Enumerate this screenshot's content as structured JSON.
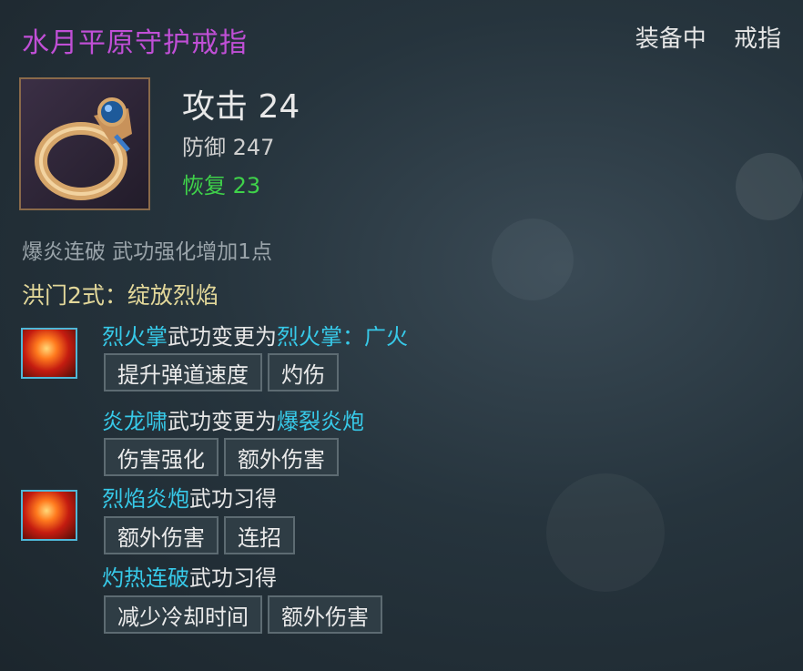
{
  "item": {
    "name": "水月平原守护戒指",
    "status": "装备中",
    "slot": "戒指",
    "attack": "攻击 24",
    "defense": "防御 247",
    "recovery": "恢复 23",
    "passive": "爆炎连破 武功强化增加1点",
    "set_name": "洪门2式：绽放烈焰",
    "icon": "ring-icon"
  },
  "skills": [
    {
      "icon": "fire-palm-skill-icon",
      "name": "烈火掌",
      "text": "武功变更为",
      "target": "烈火掌：广火",
      "tags": [
        "提升弹道速度",
        "灼伤"
      ]
    },
    {
      "name": "炎龙啸",
      "text": "武功变更为",
      "target": "爆裂炎炮",
      "tags": [
        "伤害强化",
        "额外伤害"
      ]
    },
    {
      "icon": "flame-cannon-skill-icon",
      "name": "烈焰炎炮",
      "text": "武功习得",
      "target": "",
      "tags": [
        "额外伤害",
        "连招"
      ]
    },
    {
      "name": "灼热连破",
      "text": "武功习得",
      "target": "",
      "tags": [
        "减少冷却时间",
        "额外伤害"
      ]
    }
  ],
  "colors": {
    "title": "#c04fd6",
    "highlight": "#37c9e8",
    "recovery": "#3fd24a",
    "set_name": "#e3d89a"
  }
}
